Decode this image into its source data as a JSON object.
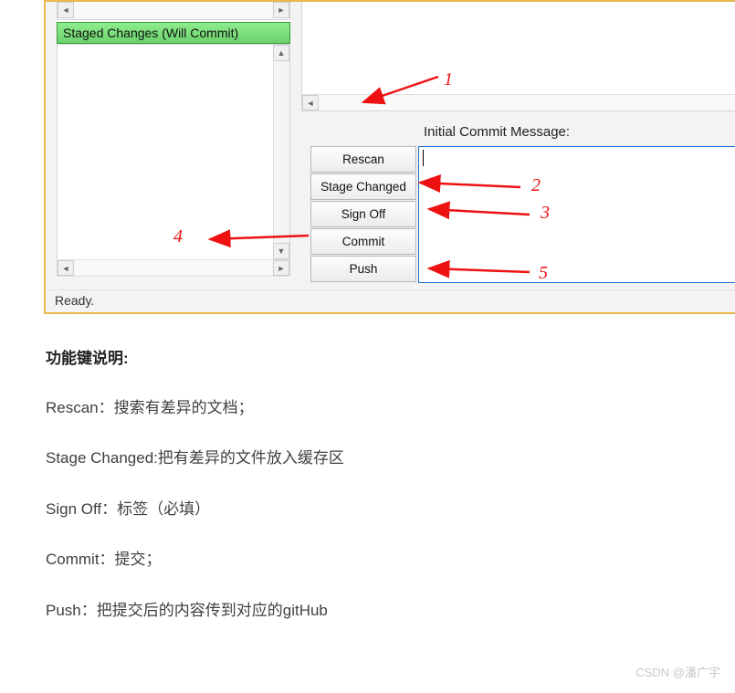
{
  "gui": {
    "staged_header": "Staged Changes (Will Commit)",
    "commit_msg_label": "Initial Commit Message:",
    "commit_msg_value": "",
    "buttons": {
      "rescan": "Rescan",
      "stage_changed": "Stage Changed",
      "sign_off": "Sign Off",
      "commit": "Commit",
      "push": "Push"
    },
    "status": "Ready."
  },
  "annotations": {
    "n1": "1",
    "n2": "2",
    "n3": "3",
    "n4": "4",
    "n5": "5"
  },
  "article": {
    "heading": "功能键说明:",
    "lines": {
      "rescan": "Rescan：搜索有差异的文档；",
      "stage": "Stage Changed:把有差异的文件放入缓存区",
      "signoff": "Sign Off：标签（必填）",
      "commit": "Commit：提交；",
      "push": "Push：把提交后的内容传到对应的gitHub"
    }
  },
  "watermark": "CSDN @潘广宇"
}
